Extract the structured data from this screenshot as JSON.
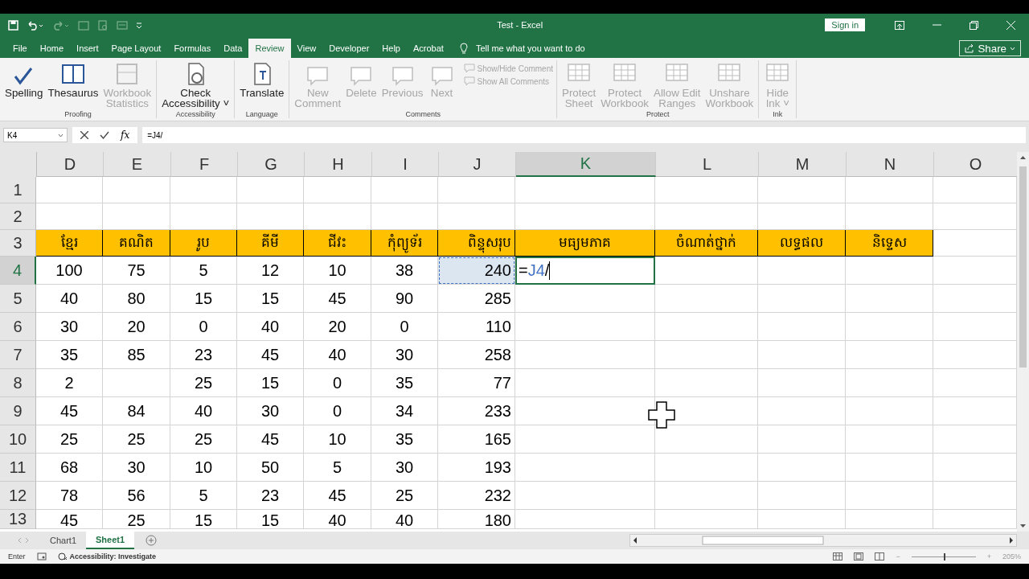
{
  "window": {
    "title": "Test  -  Excel",
    "sign_in": "Sign in"
  },
  "ribbon_tabs": [
    {
      "label": "File",
      "selected": false
    },
    {
      "label": "Home",
      "selected": false
    },
    {
      "label": "Insert",
      "selected": false
    },
    {
      "label": "Page Layout",
      "selected": false
    },
    {
      "label": "Formulas",
      "selected": false
    },
    {
      "label": "Data",
      "selected": false
    },
    {
      "label": "Review",
      "selected": true
    },
    {
      "label": "View",
      "selected": false
    },
    {
      "label": "Developer",
      "selected": false
    },
    {
      "label": "Help",
      "selected": false
    },
    {
      "label": "Acrobat",
      "selected": false
    }
  ],
  "tell_me": {
    "placeholder": "Tell me what you want to do"
  },
  "share": "Share",
  "ribbon_groups": [
    {
      "label": "Proofing",
      "buttons": [
        {
          "label": "Spelling",
          "kind": "large",
          "disabled": false
        },
        {
          "label": "Thesaurus",
          "kind": "large",
          "disabled": false
        },
        {
          "label": "Workbook\nStatistics",
          "kind": "large",
          "disabled": true
        }
      ]
    },
    {
      "label": "Accessibility",
      "buttons": [
        {
          "label": "Check\nAccessibility ˅",
          "kind": "large",
          "disabled": false
        }
      ]
    },
    {
      "label": "Language",
      "buttons": [
        {
          "label": "Translate",
          "kind": "large",
          "disabled": false
        }
      ]
    },
    {
      "label": "Comments",
      "buttons": [
        {
          "label": "New\nComment",
          "kind": "large",
          "disabled": true
        },
        {
          "label": "Delete",
          "kind": "large",
          "disabled": true
        },
        {
          "label": "Previous",
          "kind": "large",
          "disabled": true
        },
        {
          "label": "Next",
          "kind": "large",
          "disabled": true
        },
        {
          "label": "Show/Hide Comment",
          "kind": "small",
          "disabled": true
        },
        {
          "label": "Show All Comments",
          "kind": "small",
          "disabled": true
        }
      ]
    },
    {
      "label": "Protect",
      "buttons": [
        {
          "label": "Protect\nSheet",
          "kind": "large",
          "disabled": true
        },
        {
          "label": "Protect\nWorkbook",
          "kind": "large",
          "disabled": true
        },
        {
          "label": "Allow Edit\nRanges",
          "kind": "large",
          "disabled": true
        },
        {
          "label": "Unshare\nWorkbook",
          "kind": "large",
          "disabled": true
        }
      ]
    },
    {
      "label": "Ink",
      "buttons": [
        {
          "label": "Hide\nInk ˅",
          "kind": "large",
          "disabled": true
        }
      ]
    }
  ],
  "formula_bar": {
    "name_box": "K4",
    "function_button": "fx",
    "formula": "=J4/"
  },
  "columns": [
    {
      "label": "D",
      "selected": false
    },
    {
      "label": "E",
      "selected": false
    },
    {
      "label": "F",
      "selected": false
    },
    {
      "label": "G",
      "selected": false
    },
    {
      "label": "H",
      "selected": false
    },
    {
      "label": "I",
      "selected": false
    },
    {
      "label": "J",
      "selected": false
    },
    {
      "label": "K",
      "selected": true
    },
    {
      "label": "L",
      "selected": false
    },
    {
      "label": "M",
      "selected": false
    },
    {
      "label": "N",
      "selected": false
    },
    {
      "label": "O",
      "selected": false
    }
  ],
  "rows": [
    {
      "number": "1",
      "selected": false,
      "kind": "plain",
      "cells": [
        null,
        null,
        null,
        null,
        null,
        null,
        null,
        null,
        null,
        null,
        null,
        null
      ]
    },
    {
      "number": "2",
      "selected": false,
      "kind": "plain",
      "cells": [
        null,
        null,
        null,
        null,
        null,
        null,
        null,
        null,
        null,
        null,
        null,
        null
      ]
    },
    {
      "number": "3",
      "selected": false,
      "kind": "header",
      "cells": [
        "ខ្មែរ",
        "គណិត",
        "រូប",
        "គីមី",
        "ជីវះ",
        "កុំព្យូទ័រ",
        "ពិន្ទុសរុប",
        "មធ្យមភាគ",
        "ចំណាត់ថ្នាក់",
        "លទ្ធផល",
        "និទ្ទេស",
        null
      ]
    },
    {
      "number": "4",
      "selected": true,
      "kind": "plain",
      "cells": [
        "100",
        "75",
        "5",
        "12",
        "10",
        "38",
        {
          "text": "240",
          "referenced": true
        },
        {
          "parts": [
            {
              "text": "=",
              "kind": "plain"
            },
            {
              "text": "J4",
              "kind": "reference"
            },
            {
              "text": "/",
              "kind": "plain"
            }
          ],
          "editing": true
        },
        null,
        null,
        null,
        null
      ]
    },
    {
      "number": "5",
      "selected": false,
      "kind": "plain",
      "cells": [
        "40",
        "80",
        "15",
        "15",
        "45",
        "90",
        "285",
        null,
        null,
        null,
        null,
        null
      ]
    },
    {
      "number": "6",
      "selected": false,
      "kind": "plain",
      "cells": [
        "30",
        "20",
        "0",
        "40",
        "20",
        "0",
        "110",
        null,
        null,
        null,
        null,
        null
      ]
    },
    {
      "number": "7",
      "selected": false,
      "kind": "plain",
      "cells": [
        "35",
        "85",
        "23",
        "45",
        "40",
        "30",
        "258",
        null,
        null,
        null,
        null,
        null
      ]
    },
    {
      "number": "8",
      "selected": false,
      "kind": "plain",
      "cells": [
        "2",
        null,
        "25",
        "15",
        "0",
        "35",
        "77",
        null,
        null,
        null,
        null,
        null
      ]
    },
    {
      "number": "9",
      "selected": false,
      "kind": "plain",
      "cells": [
        "45",
        "84",
        "40",
        "30",
        "0",
        "34",
        "233",
        null,
        null,
        null,
        null,
        null
      ]
    },
    {
      "number": "10",
      "selected": false,
      "kind": "plain",
      "cells": [
        "25",
        "25",
        "25",
        "45",
        "10",
        "35",
        "165",
        null,
        null,
        null,
        null,
        null
      ]
    },
    {
      "number": "11",
      "selected": false,
      "kind": "plain",
      "cells": [
        "68",
        "30",
        "10",
        "50",
        "5",
        "30",
        "193",
        null,
        null,
        null,
        null,
        null
      ]
    },
    {
      "number": "12",
      "selected": false,
      "kind": "plain",
      "cells": [
        "78",
        "56",
        "5",
        "23",
        "45",
        "25",
        "232",
        null,
        null,
        null,
        null,
        null
      ]
    },
    {
      "number": "13",
      "selected": false,
      "kind": "plain",
      "cells": [
        "45",
        "25",
        "15",
        "15",
        "40",
        "40",
        "180",
        null,
        null,
        null,
        null,
        null
      ]
    }
  ],
  "sheet_tabs": [
    {
      "label": "Chart1",
      "selected": false
    },
    {
      "label": "Sheet1",
      "selected": true
    }
  ],
  "status_bar": {
    "mode": "Enter",
    "accessibility": "Accessibility: Investigate",
    "zoom": {
      "level": 0.5,
      "reading": "205%",
      "zoom_out": "−",
      "zoom_in": "+"
    }
  }
}
